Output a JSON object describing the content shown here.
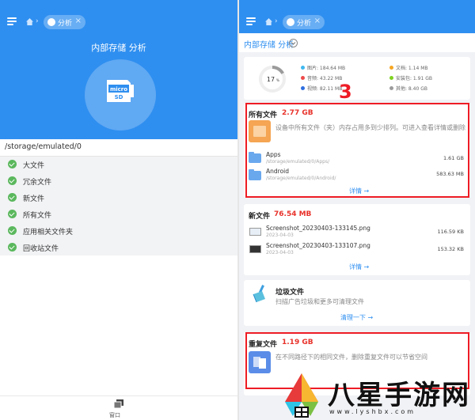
{
  "left": {
    "tab_label": "分析",
    "tab_close": "×",
    "title": "内部存储 分析",
    "path": "/storage/emulated/0",
    "items": [
      {
        "label": "大文件"
      },
      {
        "label": "冗余文件"
      },
      {
        "label": "新文件"
      },
      {
        "label": "所有文件"
      },
      {
        "label": "应用相关文件夹"
      },
      {
        "label": "回收站文件"
      }
    ],
    "bottom_label": "窗口"
  },
  "right": {
    "tab_label": "分析",
    "tab_close": "×",
    "subheader": "内部存储 分析",
    "usage": {
      "percent": "17",
      "percent_unit": "%",
      "percent_value": 17,
      "legend": [
        {
          "label": "图片: 184.64 MB",
          "color": "#3fb8f0"
        },
        {
          "label": "音频: 43.22 MB",
          "color": "#ee4b4b"
        },
        {
          "label": "视频: 82.11 MB",
          "color": "#2f6fe0"
        },
        {
          "label": "文档: 1.14 MB",
          "color": "#f5a623"
        },
        {
          "label": "安装包: 1.91 GB",
          "color": "#7ed321"
        },
        {
          "label": "其他: 8.40 GB",
          "color": "#9b9b9b"
        }
      ]
    },
    "all_files": {
      "title": "所有文件",
      "size": "2.77 GB",
      "desc": "设备中所有文件（夹）内存占用多到少排列。可进入查看详情或删除",
      "rows": [
        {
          "name": "Apps",
          "path": "/storage/emulated/0/Apps/",
          "size": "1.61 GB"
        },
        {
          "name": "Android",
          "path": "/storage/emulated/0/Android/",
          "size": "583.63 MB"
        }
      ],
      "more": "详情 →"
    },
    "new_files": {
      "title": "新文件",
      "size": "76.54 MB",
      "rows": [
        {
          "name": "Screenshot_20230403-133145.png",
          "date": "2023-04-03",
          "size": "116.59 KB"
        },
        {
          "name": "Screenshot_20230403-133107.png",
          "date": "2023-04-03",
          "size": "153.32 KB"
        }
      ],
      "more": "详情 →"
    },
    "junk": {
      "title": "垃圾文件",
      "desc": "扫描广告垃圾和更多可清理文件",
      "more": "清理一下 →"
    },
    "duplicate": {
      "title": "重复文件",
      "size": "1.19 GB",
      "desc": "在不同路径下的相同文件，删除重复文件可以节省空间"
    },
    "annotation": "3"
  },
  "watermark": {
    "text": "八星手游网",
    "url": "www.lyshbx.com"
  }
}
